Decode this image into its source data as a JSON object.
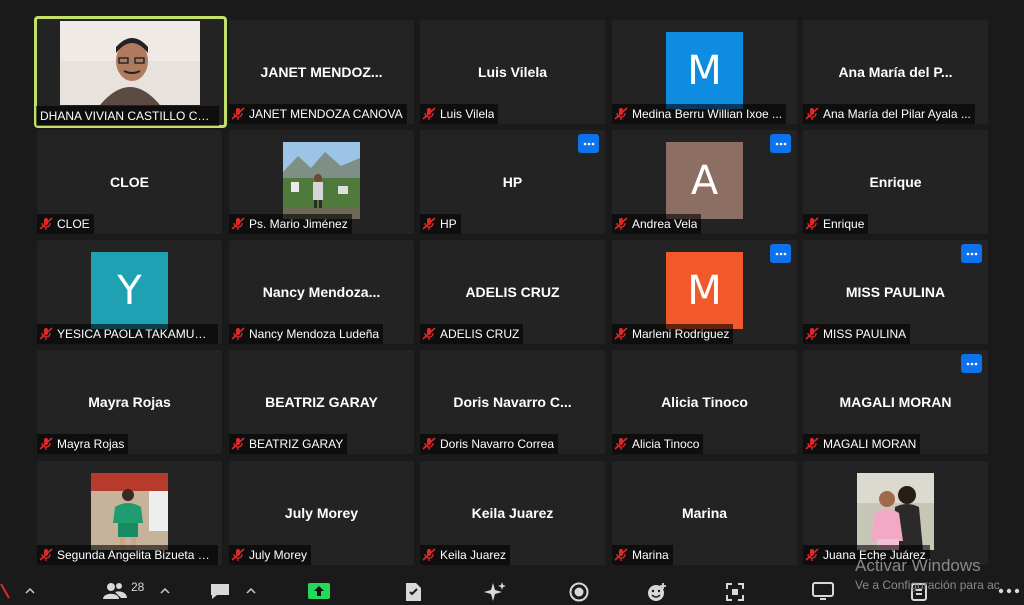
{
  "participants": [
    {
      "name": "DHANA VIVIAN CASTILLO CO...",
      "kind": "video",
      "speaker": true
    },
    {
      "name": "JANET MENDOZA CANOVA",
      "display": "JANET  MENDOZ...",
      "kind": "text"
    },
    {
      "name": "Luis Vilela",
      "display": "Luis Vilela",
      "kind": "text"
    },
    {
      "name": "Medina Berru Willian Ixoe ...",
      "kind": "avatar",
      "initial": "M",
      "color": "#0e8de0"
    },
    {
      "name": "Ana María del Pilar Ayala ...",
      "display": "Ana María del P...",
      "kind": "text"
    },
    {
      "name": "CLOE",
      "display": "CLOE",
      "kind": "text"
    },
    {
      "name": "Ps. Mario Jiménez",
      "kind": "photo",
      "photo": "mountain"
    },
    {
      "name": "HP",
      "display": "HP",
      "kind": "text",
      "more": true
    },
    {
      "name": "Andrea Vela",
      "kind": "avatar",
      "initial": "A",
      "color": "#8d6e63",
      "more": true
    },
    {
      "name": "Enrique",
      "display": "Enrique",
      "kind": "text"
    },
    {
      "name": "YESICA PAOLA TAKAMURA ...",
      "kind": "avatar",
      "initial": "Y",
      "color": "#1da1b3"
    },
    {
      "name": "Nancy Mendoza Ludeña",
      "display": "Nancy  Mendoza...",
      "kind": "text"
    },
    {
      "name": "ADELIS CRUZ",
      "display": "ADELIS CRUZ",
      "kind": "text"
    },
    {
      "name": "Marleni Rodriguez",
      "kind": "avatar",
      "initial": "M",
      "color": "#f1592a",
      "more": true
    },
    {
      "name": "MISS PAULINA",
      "display": "MISS PAULINA",
      "kind": "text",
      "more": true
    },
    {
      "name": "Mayra Rojas",
      "display": "Mayra Rojas",
      "kind": "text"
    },
    {
      "name": "BEATRIZ GARAY",
      "display": "BEATRIZ GARAY",
      "kind": "text"
    },
    {
      "name": "Doris Navarro Correa",
      "display": "Doris  Navarro  C...",
      "kind": "text"
    },
    {
      "name": "Alicia Tinoco",
      "display": "Alicia Tinoco",
      "kind": "text"
    },
    {
      "name": "MAGALI MORAN",
      "display": "MAGALI MORAN",
      "kind": "text",
      "more": true
    },
    {
      "name": "Segunda Angelita Bizueta L...",
      "kind": "photo",
      "photo": "woman"
    },
    {
      "name": "July Morey",
      "display": "July Morey",
      "kind": "text"
    },
    {
      "name": "Keila Juarez",
      "display": "Keila Juarez",
      "kind": "text"
    },
    {
      "name": "Marina",
      "display": "Marina",
      "kind": "text"
    },
    {
      "name": "Juana Eche Juárez",
      "kind": "photo",
      "photo": "pink"
    }
  ],
  "more_icon": "ellipsis-icon",
  "mic_icon": "muted-mic-icon",
  "toolbar": {
    "participant_count": "28"
  },
  "watermark": {
    "title": "Activar Windows",
    "subtitle": "Ve a Configuración para ac"
  },
  "colors": {
    "accent": "#0e72ed",
    "speaker_outline": "#c3e06a",
    "share_green": "#23d959",
    "tile_bg": "#232323",
    "background": "#1a1a1a"
  }
}
